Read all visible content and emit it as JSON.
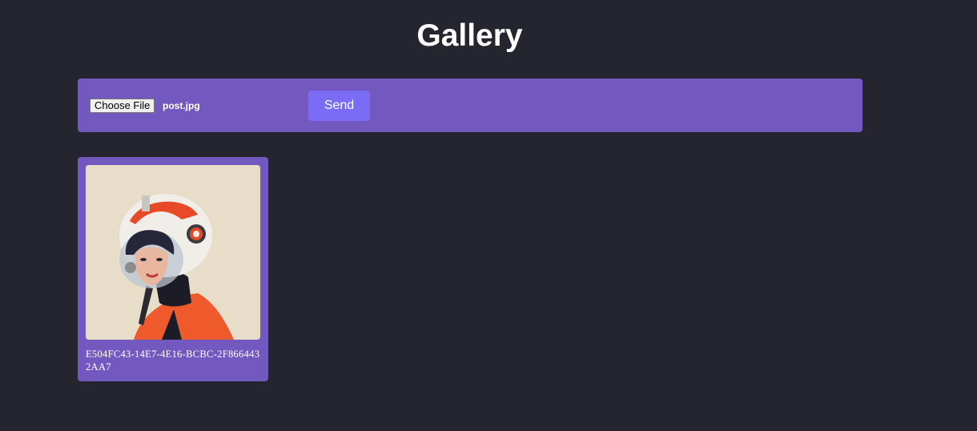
{
  "page": {
    "title": "Gallery"
  },
  "upload": {
    "choose_file_label": "Choose File",
    "file_name": "post.jpg",
    "send_label": "Send"
  },
  "gallery": {
    "items": [
      {
        "caption": "E504FC43-14E7-4E16-BCBC-2F8664432AA7",
        "image": "astronaut-girl-illustration"
      }
    ]
  },
  "colors": {
    "background": "#25252f",
    "panel": "#7358c0",
    "button": "#7b6cf6",
    "text": "#ffffff"
  }
}
